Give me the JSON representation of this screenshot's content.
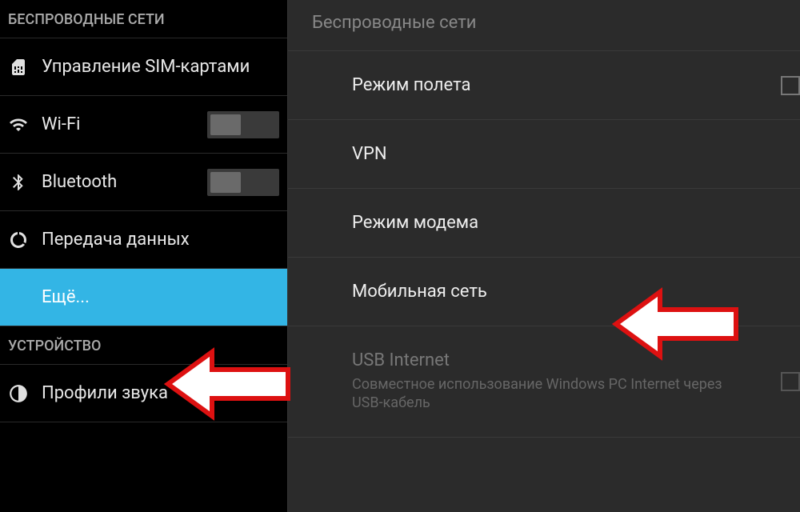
{
  "sidebar": {
    "section_wireless": "БЕСПРОВОДНЫЕ СЕТИ",
    "section_device": "УСТРОЙСТВО",
    "items": {
      "sim": "Управление SIM-картами",
      "wifi": "Wi-Fi",
      "bluetooth": "Bluetooth",
      "data": "Передача данных",
      "more": "Ещё...",
      "audio": "Профили звука"
    }
  },
  "main": {
    "header": "Беспроводные сети",
    "airplane": {
      "title": "Режим полета"
    },
    "vpn": {
      "title": "VPN"
    },
    "tethering": {
      "title": "Режим модема"
    },
    "mobile": {
      "title": "Мобильная сеть"
    },
    "usb": {
      "title": "USB Internet",
      "subtitle": "Совместное использование Windows PC Internet через USB-кабель"
    }
  }
}
